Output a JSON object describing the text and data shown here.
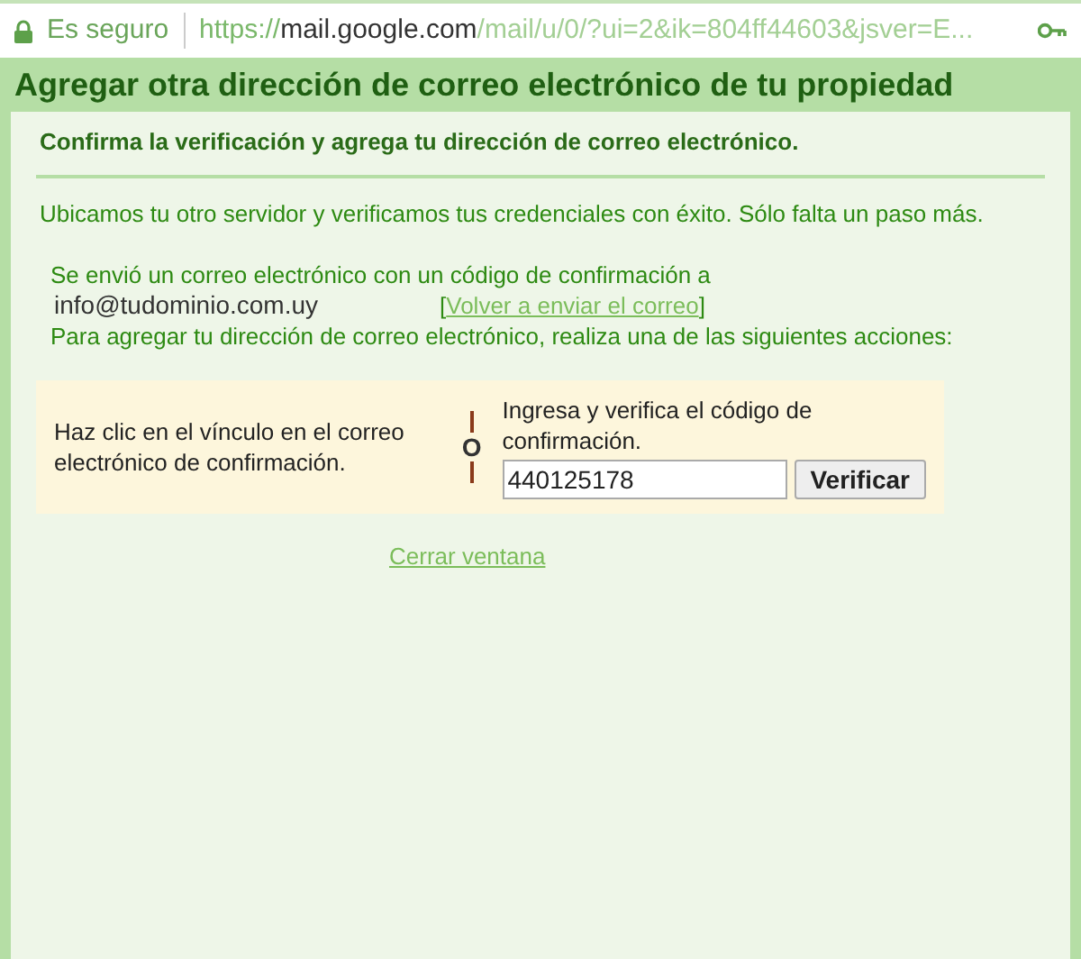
{
  "address_bar": {
    "security_label": "Es seguro",
    "url_scheme": "https://",
    "url_host": "mail.google.com",
    "url_path": "/mail/u/0/?ui=2&ik=804ff44603&jsver=E..."
  },
  "dialog": {
    "title": "Agregar otra dirección de correo electrónico de tu propiedad",
    "heading": "Confirma la verificación y agrega tu dirección de correo electrónico.",
    "intro": "Ubicamos tu otro servidor y verificamos tus credenciales con éxito. Sólo falta un paso más.",
    "sent_notice": "Se envió un correo electrónico con un código de confirmación a",
    "email": "info@tudominio.com.uy",
    "resend_open": "[",
    "resend_link": "Volver a enviar el correo",
    "resend_close": "]",
    "instruction": "Para agregar tu dirección de correo electrónico, realiza una de las siguientes acciones:",
    "option_link": "Haz clic en el vínculo en el correo electrónico de confirmación.",
    "or_label": "O",
    "option_code_label": "Ingresa y verifica el código de confirmación.",
    "code_value": "440125178",
    "verify_button": "Verificar",
    "close_link": "Cerrar ventana"
  }
}
